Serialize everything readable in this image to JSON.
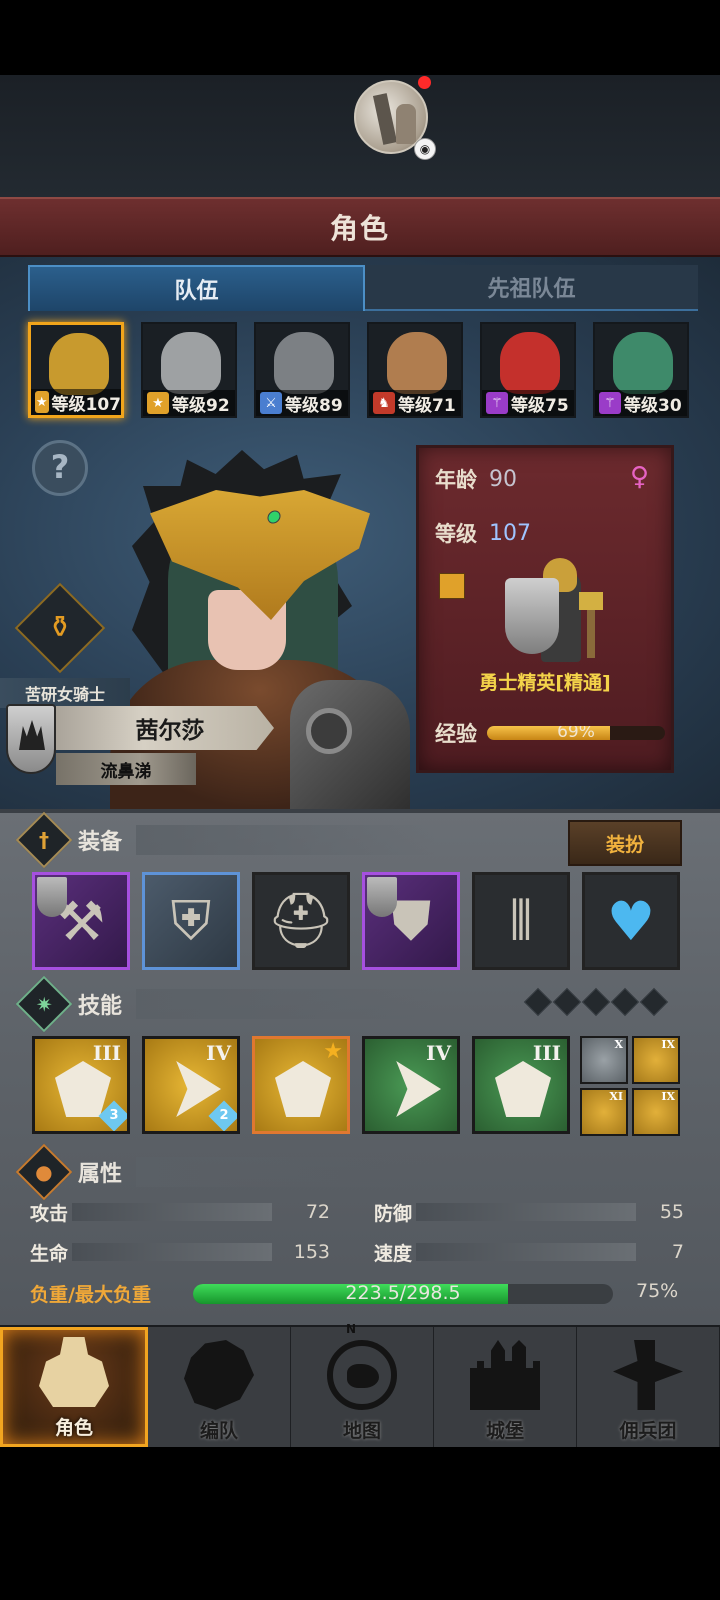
{
  "colors": {
    "accent_gold": "#f2a51b",
    "title_red": "#6e2f2f",
    "team_tab_blue": "#2b5f8c",
    "load_green": "#3fdc5a",
    "load_label": "#f0a838",
    "xp_orange": "#f7c34a",
    "rare_purple": "#a650e0",
    "uncommon_blue": "#5e93d8"
  },
  "header": {
    "title": "角色",
    "qq_badge_icon": "qq-penguin-icon"
  },
  "tabs": [
    {
      "label": "队伍",
      "active": true
    },
    {
      "label": "先祖队伍",
      "active": false
    }
  ],
  "roster": [
    {
      "level_label": "等级107",
      "class_icon": "shield-star-icon",
      "selected": true,
      "face_color": "#c89a2e"
    },
    {
      "level_label": "等级92",
      "class_icon": "shield-star-icon",
      "selected": false,
      "face_color": "#9ea1a3"
    },
    {
      "level_label": "等级89",
      "class_icon": "sword-icon",
      "selected": false,
      "face_color": "#7c8084"
    },
    {
      "level_label": "等级71",
      "class_icon": "horse-icon",
      "selected": false,
      "face_color": "#b07d4f"
    },
    {
      "level_label": "等级75",
      "class_icon": "staff-icon",
      "selected": false,
      "face_color": "#c4302c"
    },
    {
      "level_label": "等级30",
      "class_icon": "staff-icon",
      "selected": false,
      "face_color": "#3e8a6a"
    }
  ],
  "character": {
    "subclass": "苦研女骑士",
    "name": "茜尔莎",
    "trait": "流鼻涕",
    "age_label": "年龄",
    "age": "90",
    "level_label": "等级",
    "level": "107",
    "gender_icon": "female-icon",
    "class_name": "勇士精英[精通]",
    "xp_label": "经验",
    "xp_text": "69%",
    "xp_fraction": 0.69
  },
  "equipment": {
    "title": "装备",
    "dress_label": "装扮",
    "items": [
      {
        "name": "war-hammer-icon",
        "rarity": "purple",
        "has_badge": true
      },
      {
        "name": "shield-icon",
        "rarity": "blue",
        "has_badge": false
      },
      {
        "name": "helmet-icon",
        "rarity": "common",
        "has_badge": false
      },
      {
        "name": "chest-armor-icon",
        "rarity": "purple",
        "has_badge": true
      },
      {
        "name": "greaves-icon",
        "rarity": "common",
        "has_badge": false
      },
      {
        "name": "heart-amulet-icon",
        "rarity": "common",
        "has_badge": false
      }
    ]
  },
  "skills": {
    "title": "技能",
    "slots_count": 5,
    "items": [
      {
        "icon": "shield-sword-skill-icon",
        "tier": "III",
        "style": "gold",
        "count": "3"
      },
      {
        "icon": "shatter-skill-icon",
        "tier": "IV",
        "style": "gold",
        "count": "2"
      },
      {
        "icon": "dash-strike-skill-icon",
        "tier": "★",
        "style": "gold-orange",
        "count": ""
      },
      {
        "icon": "burst-skill-icon",
        "tier": "IV",
        "style": "green",
        "count": ""
      },
      {
        "icon": "crystal-skill-icon",
        "tier": "III",
        "style": "green",
        "count": ""
      }
    ],
    "mini": [
      {
        "tier": "X",
        "style": "grey"
      },
      {
        "tier": "IX",
        "style": "gold"
      },
      {
        "tier": "XI",
        "style": "gold"
      },
      {
        "tier": "IX",
        "style": "gold"
      }
    ]
  },
  "attributes": {
    "title": "属性",
    "stats": [
      {
        "label": "攻击",
        "value": "72"
      },
      {
        "label": "防御",
        "value": "55"
      },
      {
        "label": "生命",
        "value": "153"
      },
      {
        "label": "速度",
        "value": "7"
      }
    ],
    "load_label": "负重/最大负重",
    "load_text": "223.5/298.5",
    "load_fraction": 0.75,
    "load_pct": "75%"
  },
  "nav": [
    {
      "label": "角色",
      "icon": "knight-icon",
      "active": true
    },
    {
      "label": "编队",
      "icon": "formation-icon",
      "active": false
    },
    {
      "label": "地图",
      "icon": "compass-map-icon",
      "active": false
    },
    {
      "label": "城堡",
      "icon": "castle-icon",
      "active": false
    },
    {
      "label": "佣兵团",
      "icon": "mercenary-icon",
      "active": false
    }
  ],
  "map_compass_letter": "N"
}
